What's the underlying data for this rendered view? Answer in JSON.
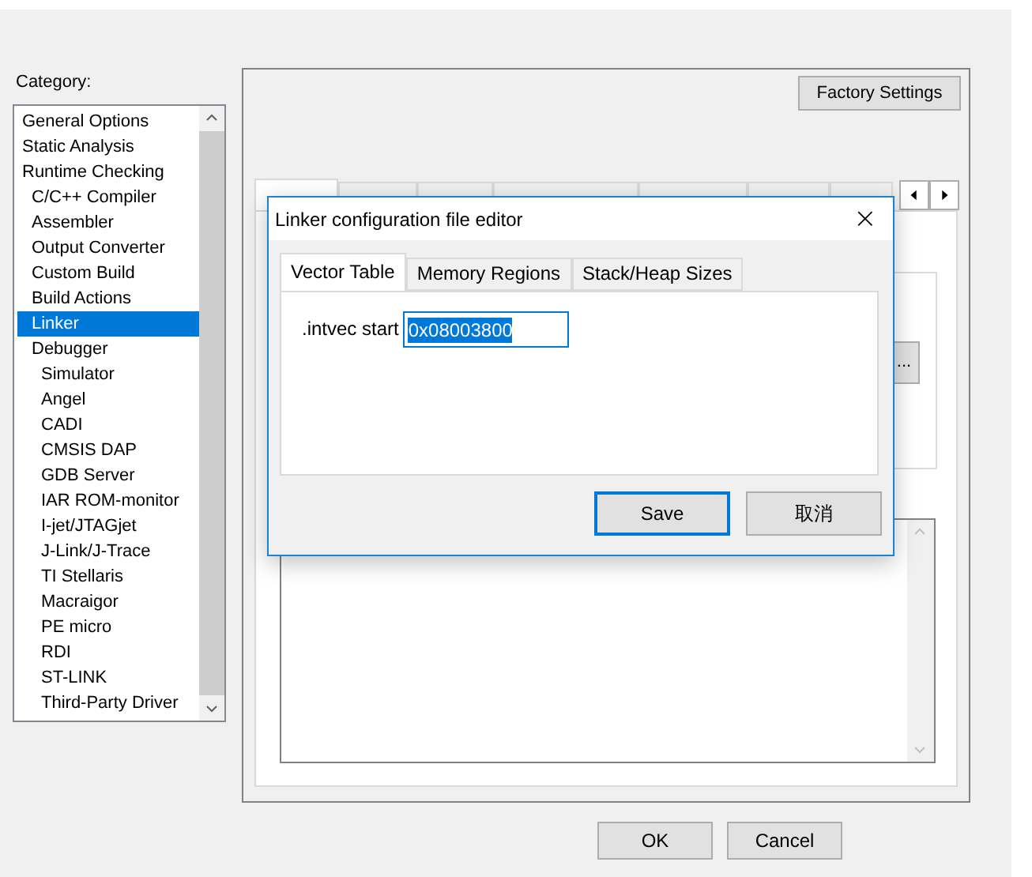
{
  "category_label": "Category:",
  "categories": [
    {
      "label": "General Options",
      "selected": false
    },
    {
      "label": "Static Analysis",
      "selected": false
    },
    {
      "label": "Runtime Checking",
      "selected": false,
      "children": [
        {
          "label": "C/C++ Compiler",
          "selected": false
        },
        {
          "label": "Assembler",
          "selected": false
        },
        {
          "label": "Output Converter",
          "selected": false
        },
        {
          "label": "Custom Build",
          "selected": false
        },
        {
          "label": "Build Actions",
          "selected": false
        },
        {
          "label": "Linker",
          "selected": true
        },
        {
          "label": "Debugger",
          "selected": false,
          "children": [
            {
              "label": "Simulator",
              "selected": false
            },
            {
              "label": "Angel",
              "selected": false
            },
            {
              "label": "CADI",
              "selected": false
            },
            {
              "label": "CMSIS DAP",
              "selected": false
            },
            {
              "label": "GDB Server",
              "selected": false
            },
            {
              "label": "IAR ROM-monitor",
              "selected": false
            },
            {
              "label": "I-jet/JTAGjet",
              "selected": false
            },
            {
              "label": "J-Link/J-Trace",
              "selected": false
            },
            {
              "label": "TI Stellaris",
              "selected": false
            },
            {
              "label": "Macraigor",
              "selected": false
            },
            {
              "label": "PE micro",
              "selected": false
            },
            {
              "label": "RDI",
              "selected": false
            },
            {
              "label": "ST-LINK",
              "selected": false
            },
            {
              "label": "Third-Party Driver",
              "selected": false
            }
          ]
        }
      ]
    }
  ],
  "factory_button": "Factory Settings",
  "tabs": [
    {
      "selected": true
    },
    {
      "selected": false
    },
    {
      "selected": false
    },
    {
      "selected": false
    },
    {
      "selected": false
    },
    {
      "selected": false
    },
    {
      "selected": false
    }
  ],
  "browse_button": "...",
  "buttons": [
    "OK",
    "Cancel"
  ],
  "dialog": {
    "title": "Linker configuration file editor",
    "close": "×",
    "tabs": [
      {
        "label": "Vector Table",
        "selected": true
      },
      {
        "label": "Memory Regions",
        "selected": false
      },
      {
        "label": "Stack/Heap Sizes",
        "selected": false
      }
    ],
    "field": {
      "label": ".intvec start",
      "value": "0x08003800"
    },
    "buttons": [
      {
        "label": "Save",
        "default": true
      },
      {
        "label": "取消",
        "default": false
      }
    ]
  }
}
